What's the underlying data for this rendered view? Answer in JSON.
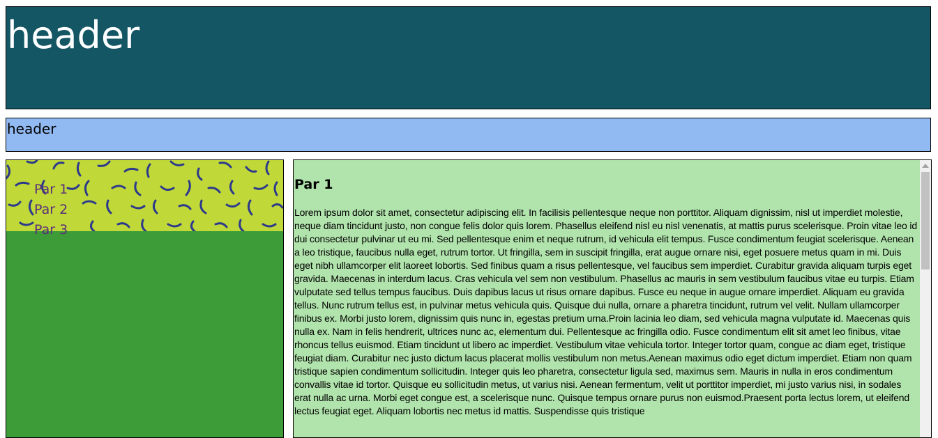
{
  "header": {
    "title": "header"
  },
  "subheader": {
    "title": "header"
  },
  "sidebar": {
    "items": [
      {
        "label": "Par 1"
      },
      {
        "label": "Par 2"
      },
      {
        "label": "Par 3"
      }
    ]
  },
  "content": {
    "heading": "Par 1",
    "body": "Lorem ipsum dolor sit amet, consectetur adipiscing elit. In facilisis pellentesque neque non porttitor. Aliquam dignissim, nisl ut imperdiet molestie, neque diam tincidunt justo, non congue felis dolor quis lorem. Phasellus eleifend nisl eu nisl venenatis, at mattis purus scelerisque. Proin vitae leo id dui consectetur pulvinar ut eu mi. Sed pellentesque enim et neque rutrum, id vehicula elit tempus. Fusce condimentum feugiat scelerisque. Aenean a leo tristique, faucibus nulla eget, rutrum tortor. Ut fringilla, sem in suscipit fringilla, erat augue ornare nisi, eget posuere metus quam in mi. Duis eget nibh ullamcorper elit laoreet lobortis. Sed finibus quam a risus pellentesque, vel faucibus sem imperdiet. Curabitur gravida aliquam turpis eget gravida. Maecenas in interdum lacus. Cras vehicula vel sem non vestibulum. Phasellus ac mauris in sem vestibulum faucibus vitae eu turpis. Etiam vulputate sed tellus tempus faucibus. Duis dapibus lacus ut risus ornare dapibus. Fusce eu neque in augue ornare imperdiet. Aliquam eu gravida tellus. Nunc rutrum tellus est, in pulvinar metus vehicula quis. Quisque dui nulla, ornare a pharetra tincidunt, rutrum vel velit. Nullam ullamcorper finibus ex. Morbi justo lorem, dignissim quis nunc in, egestas pretium urna.Proin lacinia leo diam, sed vehicula magna vulputate id. Maecenas quis nulla ex. Nam in felis hendrerit, ultrices nunc ac, elementum dui. Pellentesque ac fringilla odio. Fusce condimentum elit sit amet leo finibus, vitae rhoncus tellus euismod. Etiam tincidunt ut libero ac imperdiet. Vestibulum vitae vehicula tortor. Integer tortor quam, congue ac diam eget, tristique feugiat diam. Curabitur nec justo dictum lacus placerat mollis vestibulum non metus.Aenean maximus odio eget dictum imperdiet. Etiam non quam tristique sapien condimentum sollicitudin. Integer quis leo pharetra, consectetur ligula sed, maximus sem. Mauris in nulla in eros condimentum convallis vitae id tortor. Quisque eu sollicitudin metus, ut varius nisi. Aenean fermentum, velit ut porttitor imperdiet, mi justo varius nisi, in sodales erat nulla ac urna. Morbi eget congue est, a scelerisque nunc. Quisque tempus ornare purus non euismod.Praesent porta lectus lorem, ut eleifend lectus feugiat eget. Aliquam lobortis nec metus id mattis. Suspendisse quis tristique"
  },
  "colors": {
    "header_bg": "#145664",
    "subheader_bg": "#92baf2",
    "sidebar_bg": "#3d9c37",
    "pattern_bg": "#c0d838",
    "pattern_stroke": "#2d3a8c",
    "nav_text": "#5a2e7a",
    "content_bg": "#b1e3ac"
  }
}
